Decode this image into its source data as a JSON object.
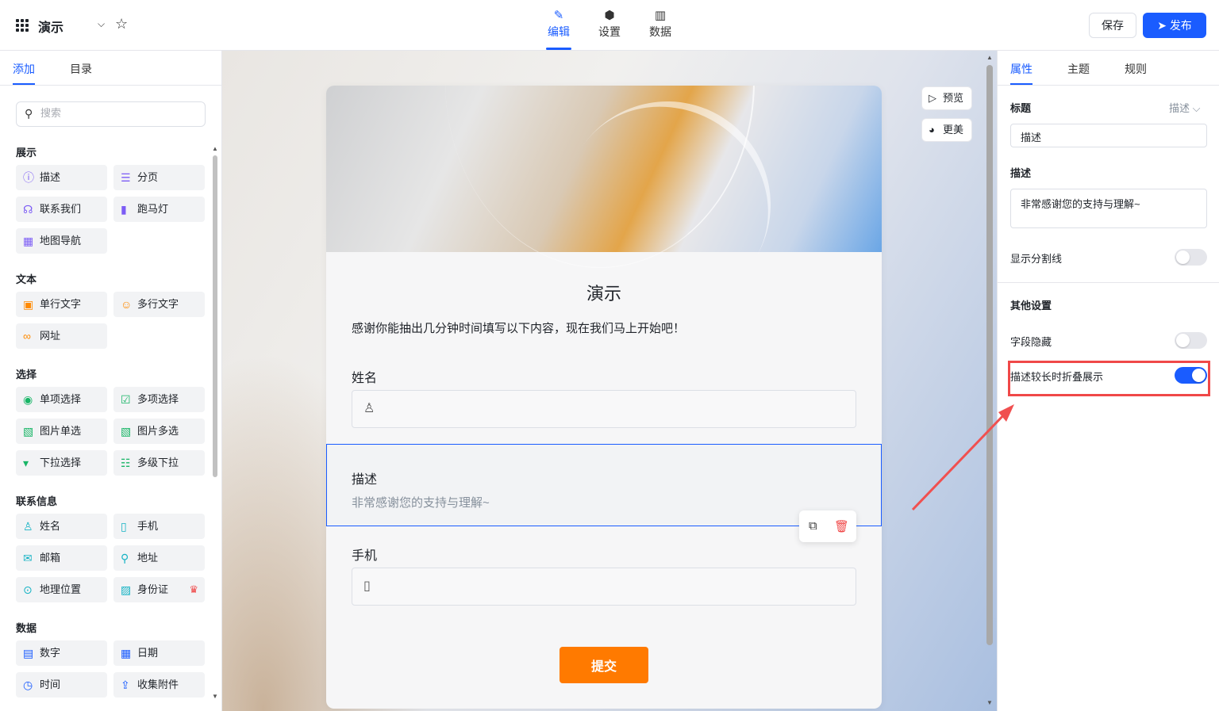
{
  "header": {
    "title": "演示",
    "nav": [
      {
        "label": "编辑",
        "icon": "pen-icon",
        "active": true
      },
      {
        "label": "设置",
        "icon": "gear-icon",
        "active": false
      },
      {
        "label": "数据",
        "icon": "bar-chart-icon",
        "active": false
      }
    ],
    "save_label": "保存",
    "publish_label": "发布",
    "accent_color": "#1a5cff"
  },
  "left": {
    "tabs": [
      "添加",
      "目录"
    ],
    "search_placeholder": "搜索",
    "sections": [
      {
        "title": "展示",
        "items": [
          "描述",
          "分页",
          "联系我们",
          "跑马灯",
          "地图导航"
        ]
      },
      {
        "title": "文本",
        "items": [
          "单行文字",
          "多行文字",
          "网址"
        ]
      },
      {
        "title": "选择",
        "items": [
          "单项选择",
          "多项选择",
          "图片单选",
          "图片多选",
          "下拉选择",
          "多级下拉"
        ]
      },
      {
        "title": "联系信息",
        "items": [
          "姓名",
          "手机",
          "邮箱",
          "地址",
          "地理位置",
          "身份证"
        ]
      },
      {
        "title": "数据",
        "items": [
          "数字",
          "日期",
          "时间",
          "收集附件"
        ]
      }
    ]
  },
  "form": {
    "title": "演示",
    "intro": "感谢你能抽出几分钟时间填写以下内容，现在我们马上开始吧！",
    "name_label": "姓名",
    "desc_label": "描述",
    "desc_text": "非常感谢您的支持与理解~",
    "phone_label": "手机",
    "submit_label": "提交",
    "submit_color": "#ff7a00"
  },
  "canvas_buttons": {
    "preview": "预览",
    "beautify": "更美"
  },
  "right": {
    "tabs": [
      "属性",
      "主题",
      "规则"
    ],
    "title_label": "标题",
    "title_select": "描述",
    "title_value": "描述",
    "desc_label": "描述",
    "desc_value": "非常感谢您的支持与理解~",
    "show_divider_label": "显示分割线",
    "show_divider_on": false,
    "other_settings_label": "其他设置",
    "hide_field_label": "字段隐藏",
    "hide_field_on": false,
    "collapse_label": "描述较长时折叠展示",
    "collapse_on": true
  }
}
